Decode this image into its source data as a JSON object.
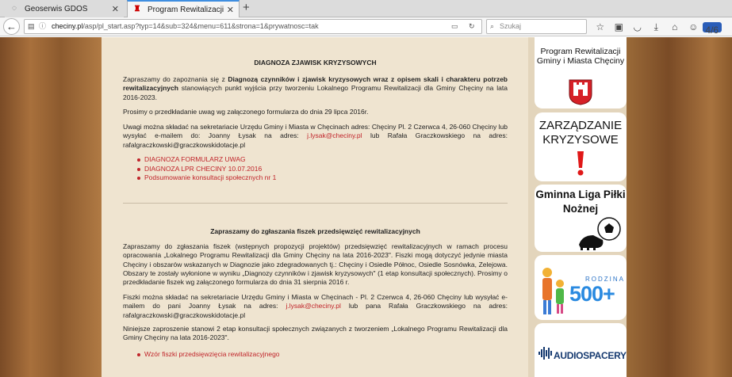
{
  "browser": {
    "tabs": [
      {
        "label": "Geoserwis GDOŚ",
        "close": "✕"
      },
      {
        "label": "Program Rewitalizacji Gmi...",
        "close": "✕"
      }
    ],
    "new_tab": "+",
    "url_domain": "checiny.pl",
    "url_path": "/asp/pl_start.asp?typ=14&sub=324&menu=611&strona=1&prywatnosc=tak",
    "search_placeholder": "Szukaj",
    "badge": "4/6"
  },
  "section1": {
    "heading": "DIAGNOZA ZJAWISK KRYZYSOWYCH",
    "p1_a": "Zapraszamy do zapoznania się z ",
    "p1_b": "Diagnozą czynników i zjawisk kryzysowych wraz z opisem skali i charakteru potrzeb rewitalizacyjnych",
    "p1_c": " stanowiących punkt wyjścia przy tworzeniu Lokalnego Programu Rewitalizacji dla Gminy Chęciny na lata 2016-2023.",
    "p2": "Prosimy o przedkładanie uwag wg załączonego formularza do dnia 29 lipca 2016r.",
    "p3_a": "Uwagi można składać na sekretariacie Urzędu Gminy i Miasta w Chęcinach adres: Chęciny Pl. 2 Czerwca 4, 26-060 Chęciny lub wysyłać e-mailem do: Joanny Łysak na adres: ",
    "p3_email": "j.lysak@checiny.pl",
    "p3_b": " lub Rafała Graczkowskiego na adres: rafalgraczkowski@graczkowskidotacje.pl",
    "links": [
      " DIAGNOZA FORMULARZ UWAG",
      "DIAGNOZA LPR CHECINY 10.07.2016",
      "Podsumowanie konsultacji społecznych nr 1"
    ]
  },
  "section2": {
    "heading": "Zapraszamy do zgłaszania fiszek przedsięwzięć rewitalizacyjnych",
    "p1": "Zapraszamy do zgłaszania fiszek (wstępnych propozycji projektów) przedsięwzięć rewitalizacyjnych w ramach procesu opracowania „Lokalnego Programu Rewitalizacji dla Gminy Chęciny na lata 2016-2023\". Fiszki mogą dotyczyć jedynie miasta Chęciny i obszarów wskazanych w Diagnozie jako zdegradowanych tj.: Chęciny i Osiedle Północ, Osiedle Sosnówka, Zelejowa. Obszary te zostały wyłonione w wyniku „Diagnozy czynników i zjawisk kryzysowych\" (1 etap konsultacji społecznych). Prosimy o przedkładanie fiszek wg załączonego formularza do dnia 31 sierpnia 2016 r.",
    "p2_a": "Fiszki można składać na sekretariacie Urzędu Gminy i Miasta w Chęcinach - Pl. 2 Czerwca 4, 26-060 Chęciny lub wysyłać e-mailem do pani Joanny Łysak na adres: ",
    "p2_email": "j.lysak@checiny.pl",
    "p2_b": " lub pana Rafała Graczkowskiego na adres: rafalgraczkowski@graczkowskidotacje.pl",
    "p3": "Niniejsze zaproszenie stanowi 2 etap konsultacji społecznych związanych z tworzeniem „Lokalnego Programu Rewitalizacji dla Gminy Chęciny na lata 2016-2023\".",
    "links": [
      "Wzór fiszki przedsięwzięcia rewitalizacyjnego"
    ]
  },
  "sidebar": {
    "card1": "Program Rewitalizacji Gminy i Miasta Chęciny",
    "card2": "ZARZĄDZANIE KRYZYSOWE",
    "card3": "Gminna Liga Piłki Nożnej",
    "card4_label": "RODZINA",
    "card4_num": "500+",
    "card5": "AUDIOSPACERY"
  }
}
